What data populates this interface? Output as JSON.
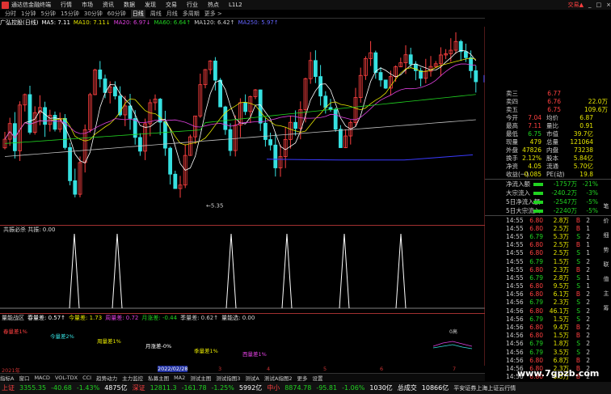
{
  "app": {
    "title": "通达信金融终端",
    "menu": [
      "行情",
      "市场",
      "资讯",
      "数据",
      "发现",
      "交易",
      "行业",
      "热点",
      "L1L2"
    ],
    "right_label": "交易▲"
  },
  "periods": [
    "分时",
    "1分钟",
    "5分钟",
    "15分钟",
    "30分钟",
    "60分钟",
    "日线",
    "周线",
    "月线",
    "多周期",
    "更多 >"
  ],
  "ma_line": {
    "stock": "广弘控股(日线)",
    "ma5": "MA5: 7.11",
    "ma10": "MA10: 7.11↓",
    "ma20": "MA20: 6.97↓",
    "ma60": "MA60: 6.64↑",
    "ma120": "MA120: 6.42↑",
    "ma250": "MA250: 5.97↑"
  },
  "price_axis": [
    "7.20",
    "7.00",
    "6.80",
    "6.60",
    "6.40",
    "6.20",
    "6.00",
    "5.80",
    "5.60",
    "5.40"
  ],
  "low_mark": "5.35",
  "last_price_tag": "6.79",
  "osc": {
    "title": "共振必杀  共振: 0.00",
    "axis": [
      "1.00",
      "0.90",
      "0.80",
      "0.70",
      "0.60",
      "0.50",
      "0.40",
      "0.30",
      "0.20",
      "0.10",
      "0.00"
    ]
  },
  "vol": {
    "legend": [
      "量能战区",
      "春量差: 0.57↑",
      "今量差: 1.73",
      "周量差: 0.72",
      "月涨差: -0.44",
      "季量差: 0.62↑",
      "量能选: 0.00"
    ],
    "labels": [
      "春量差1%",
      "今量差2%",
      "周量差1%",
      "月涨差-0%",
      "季量差1%",
      "西量差1%"
    ],
    "zero_label": "0高"
  },
  "quote": {
    "asks": [
      [
        "卖三",
        "6.77",
        ""
      ],
      [
        "卖四",
        "6.76",
        "22.0万"
      ],
      [
        "卖五",
        "6.75",
        "109.6万"
      ]
    ],
    "rows": [
      [
        "今开",
        "7.04",
        "均价",
        "6.87"
      ],
      [
        "最高",
        "7.11",
        "量比",
        "0.91"
      ],
      [
        "最低",
        "6.75",
        "市值",
        "39.7亿"
      ],
      [
        "现量",
        "479",
        "总量",
        "121064"
      ],
      [
        "外盘",
        "47826",
        "内盘",
        "73238"
      ],
      [
        "换手",
        "2.12%",
        "股本",
        "5.84亿"
      ],
      [
        "净资",
        "4.05",
        "流通",
        "5.70亿"
      ],
      [
        "收益(一)",
        "0.085",
        "PE(动)",
        "19.8"
      ]
    ]
  },
  "fund_flow": [
    [
      "净流入额",
      "-1757万",
      "-21%"
    ],
    [
      "大宗流入",
      "-240.2万",
      "-3%"
    ],
    [
      "5日净流入额",
      "-2547万",
      "-5%"
    ],
    [
      "5日大宗流入",
      "-2240万",
      "-5%"
    ]
  ],
  "trades": [
    [
      "14:55",
      "6.80",
      "2.8万",
      "B",
      "2"
    ],
    [
      "14:55",
      "6.80",
      "2.5万",
      "B",
      "1"
    ],
    [
      "14:55",
      "6.79",
      "5.3万",
      "S",
      "2"
    ],
    [
      "14:55",
      "6.80",
      "2.5万",
      "B",
      "1"
    ],
    [
      "14:55",
      "6.80",
      "2.5万",
      "S",
      "1"
    ],
    [
      "14:55",
      "6.79",
      "1.5万",
      "S",
      "2"
    ],
    [
      "14:55",
      "6.80",
      "2.3万",
      "B",
      "2"
    ],
    [
      "14:55",
      "6.79",
      "2.8万",
      "S",
      "1"
    ],
    [
      "14:55",
      "6.80",
      "9.5万",
      "S",
      "1"
    ],
    [
      "14:56",
      "6.80",
      "6.1万",
      "B",
      "2"
    ],
    [
      "14:56",
      "6.79",
      "2.3万",
      "S",
      "2"
    ],
    [
      "14:56",
      "6.80",
      "46.1万",
      "S",
      "2"
    ],
    [
      "14:56",
      "6.79",
      "1.5万",
      "S",
      "2"
    ],
    [
      "14:56",
      "6.80",
      "9.4万",
      "B",
      "2"
    ],
    [
      "14:56",
      "6.80",
      "1.5万",
      "B",
      "2"
    ],
    [
      "14:56",
      "6.79",
      "1.8万",
      "S",
      "2"
    ],
    [
      "14:56",
      "6.79",
      "3.5万",
      "S",
      "2"
    ],
    [
      "14:56",
      "6.80",
      "6.8万",
      "B",
      "2"
    ],
    [
      "14:56",
      "6.80",
      "2.3万",
      "B",
      "2"
    ],
    [
      "14:56",
      "6.80",
      "5.5万",
      "B",
      "2"
    ],
    [
      "15:00",
      "6.79",
      "479",
      "S",
      "86"
    ]
  ],
  "tabs": [
    "扩展A",
    "关联股份",
    "资金分布",
    "综合资讯",
    "行业资讯",
    "互动词谱",
    "省用户编制专辑"
  ],
  "chart_tabs": [
    "指标A",
    "窗口",
    "MACD",
    "VOL-TDX",
    "CCI",
    "趋势动力",
    "主力监控",
    "私募主图",
    "MA2",
    "测试主图",
    "测试指图3",
    "测试A",
    "测试A指图2",
    "更多",
    "设置"
  ],
  "right_tabs": [
    "笔",
    "价",
    "细",
    "势",
    "联",
    "值",
    "主",
    "筹"
  ],
  "dates": [
    "2021年",
    "2022/02/28",
    "3",
    "4",
    "5",
    "6",
    "7"
  ],
  "statusbar": {
    "sh_label": "上证",
    "sh_val": "3355.35",
    "sh_chg": "-40.68",
    "sh_pct": "-1.43%",
    "sh_amt": "4875亿",
    "sz_label": "深证",
    "sz_val": "12811.3",
    "sz_chg": "-161.78",
    "sz_pct": "-1.25%",
    "sz_amt": "5992亿",
    "zx_label": "中小",
    "zx_val": "8874.78",
    "zx_chg": "-95.81",
    "zx_pct": "-1.06%",
    "zx_amt": "1030亿",
    "total_label": "总成交",
    "total_val": "10866亿",
    "news": "平安证券上海上证云行情",
    "watermark": "www.7gpzb.com"
  },
  "colors": {
    "up": "#ff4040",
    "down": "#36e0e0",
    "ma5": "#ffffff",
    "ma10": "#e6e600",
    "ma20": "#e040e0",
    "ma60": "#21d321",
    "ma120": "#c0c0c0",
    "ma250": "#3a3aff"
  }
}
